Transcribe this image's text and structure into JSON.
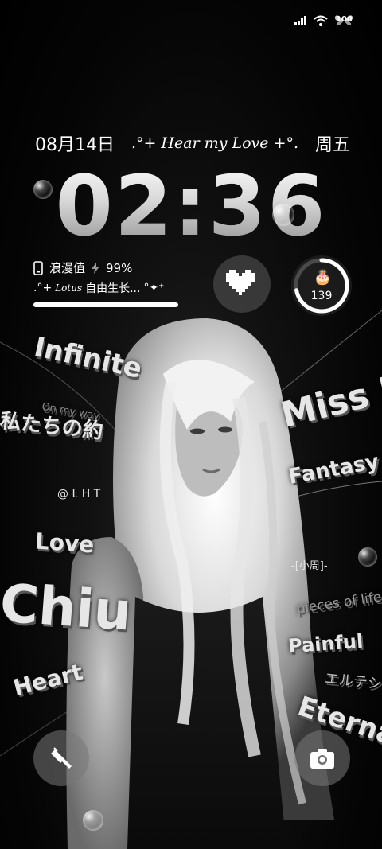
{
  "status_bar": {
    "battery": "100",
    "icons": [
      "signal-icon",
      "wifi-icon",
      "battery-icon"
    ]
  },
  "lockscreen": {
    "date": "08月14日",
    "tagline": ".°+ Hear my Love +°.",
    "weekday": "周五",
    "time": "02:36"
  },
  "widgets": {
    "romance_label": "浪漫值",
    "romance_value": "99%",
    "motto_prefix": ".°+",
    "motto_latin": "Lotus",
    "motto_text": "自由生长...",
    "motto_suffix": "°✦⁺",
    "romance_progress": 0.99,
    "day_count": "139",
    "day_count_progress": 0.72
  },
  "wallpaper": {
    "words": {
      "infinite": "Infinite",
      "on_my_way": "On my way",
      "watashi": "私たちの約",
      "lht": "@ L H T",
      "love": "Love",
      "chiu": "Chiu",
      "heart": "Heart",
      "miss_u": "Miss U",
      "fantasy": "Fantasy",
      "xiaozhou": "-[小周]-",
      "pieces": "pieces of life",
      "painful": "Painful",
      "eterna_jp": "エルテシ",
      "eternal": "Eternal"
    }
  },
  "shortcuts": {
    "left": "flashlight-icon",
    "right": "camera-icon"
  }
}
